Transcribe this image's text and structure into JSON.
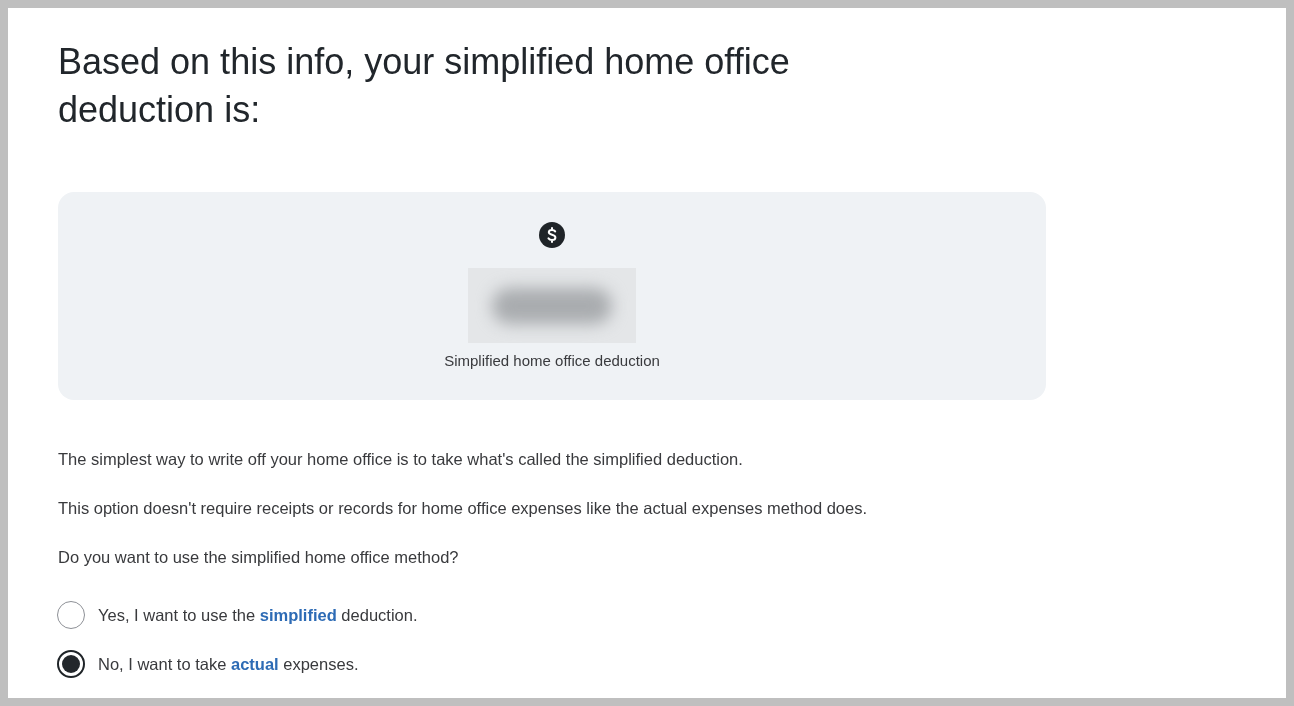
{
  "heading": "Based on this info, your simplified home office deduction is:",
  "summary_card": {
    "caption": "Simplified home office deduction"
  },
  "paragraphs": [
    "The simplest way to write off your home office is to take what's called the simplified deduction.",
    "This option doesn't require receipts or records for home office expenses like the actual expenses method does.",
    "Do you want to use the simplified home office method?"
  ],
  "options": [
    {
      "label": "Yes, I want to use the **simplified** deduction.",
      "selected": false
    },
    {
      "label": "No, I want to take **actual** expenses.",
      "selected": true
    }
  ]
}
